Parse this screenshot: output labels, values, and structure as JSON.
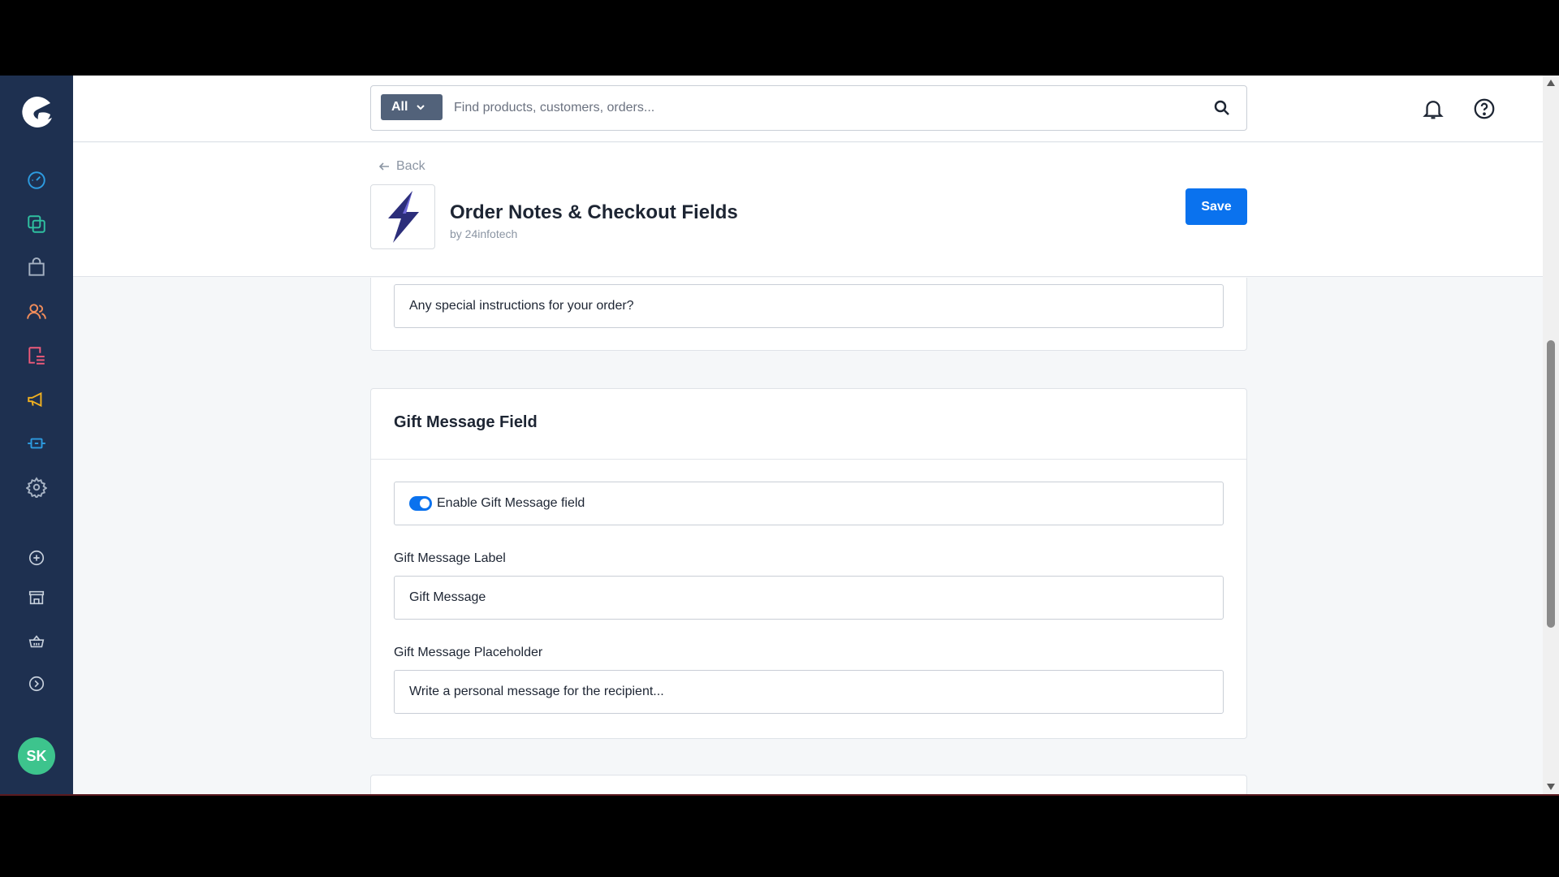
{
  "search": {
    "scope": "All",
    "placeholder": "Find products, customers, orders..."
  },
  "nav": {
    "back_label": "Back"
  },
  "app": {
    "title": "Order Notes & Checkout Fields",
    "author": "by 24infotech"
  },
  "actions": {
    "save_label": "Save"
  },
  "previous_section": {
    "field_value": "Any special instructions for your order?"
  },
  "gift_section": {
    "title": "Gift Message Field",
    "toggle_label": "Enable Gift Message field",
    "toggle_on": true,
    "label_field_label": "Gift Message Label",
    "label_field_value": "Gift Message",
    "placeholder_field_label": "Gift Message Placeholder",
    "placeholder_field_value": "Write a personal message for the recipient..."
  },
  "user": {
    "initials": "SK"
  },
  "colors": {
    "sidebar": "#1e3050",
    "accent": "#0a72ee",
    "avatar": "#3dc48d"
  },
  "sidebar_icons": [
    "dashboard-icon",
    "catalogues-icon",
    "orders-icon",
    "customers-icon",
    "content-icon",
    "marketing-icon",
    "extensions-icon",
    "settings-icon",
    "add-sales-channel-icon",
    "storefront-icon",
    "headless-icon",
    "more-icon"
  ]
}
